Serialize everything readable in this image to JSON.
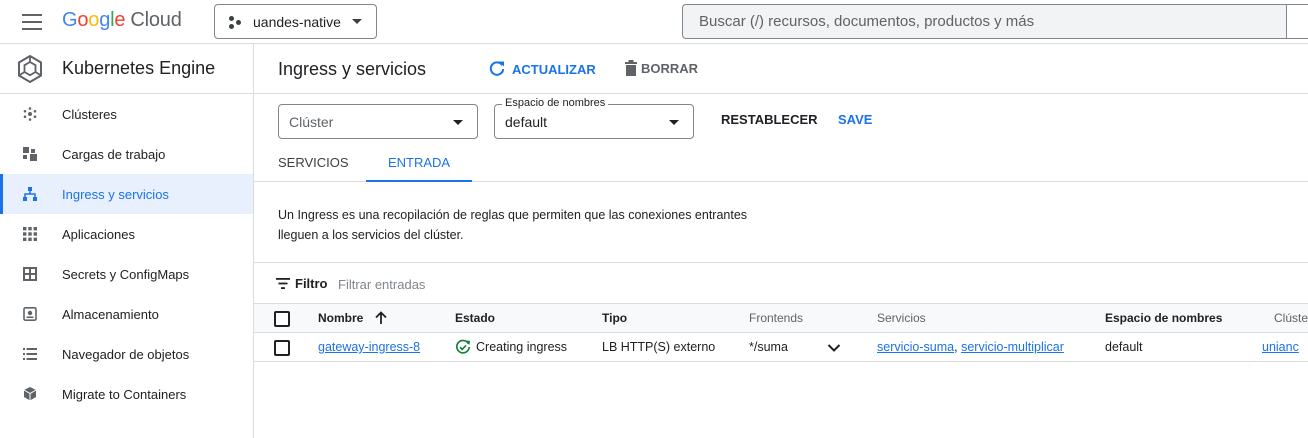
{
  "topbar": {
    "logo_google": [
      "G",
      "o",
      "o",
      "g",
      "l",
      "e"
    ],
    "logo_cloud": "Cloud",
    "project": "uandes-native",
    "search_placeholder": "Buscar (/) recursos, documentos, productos y más"
  },
  "sidebar": {
    "title": "Kubernetes Engine",
    "items": [
      {
        "label": "Clústeres",
        "icon": "clusters-icon"
      },
      {
        "label": "Cargas de trabajo",
        "icon": "workloads-icon"
      },
      {
        "label": "Ingress y servicios",
        "icon": "ingress-icon",
        "active": true
      },
      {
        "label": "Aplicaciones",
        "icon": "apps-grid-icon"
      },
      {
        "label": "Secrets y ConfigMaps",
        "icon": "secrets-icon"
      },
      {
        "label": "Almacenamiento",
        "icon": "storage-icon"
      },
      {
        "label": "Navegador de objetos",
        "icon": "object-browser-icon"
      },
      {
        "label": "Migrate to Containers",
        "icon": "migrate-icon"
      }
    ]
  },
  "header": {
    "title": "Ingress y servicios",
    "refresh_label": "ACTUALIZAR",
    "delete_label": "BORRAR"
  },
  "filters": {
    "cluster_placeholder": "Clúster",
    "namespace_legend": "Espacio de nombres",
    "namespace_value": "default",
    "reset_label": "RESTABLECER",
    "save_label": "SAVE"
  },
  "tabs": [
    {
      "label": "SERVICIOS"
    },
    {
      "label": "ENTRADA",
      "active": true
    }
  ],
  "description": {
    "line1": "Un Ingress es una recopilación de reglas que permiten que las conexiones entrantes",
    "line2": "lleguen a los servicios del clúster."
  },
  "filter_bar": {
    "label": "Filtro",
    "placeholder": "Filtrar entradas"
  },
  "table": {
    "columns": [
      "Nombre",
      "Estado",
      "Tipo",
      "Frontends",
      "Servicios",
      "Espacio de nombres",
      "Clúste"
    ],
    "rows": [
      {
        "name": "gateway-ingress-8",
        "status": "Creating ingress",
        "type": "LB HTTP(S) externo",
        "frontend": "*/suma",
        "services": [
          "servicio-suma",
          "servicio-multiplicar"
        ],
        "service_separator": ",",
        "namespace": "default",
        "cluster": "unianc"
      }
    ]
  },
  "colors": {
    "accent": "#1a73e8",
    "status_ok": "#188038",
    "active_bg": "#e8f0fe"
  }
}
